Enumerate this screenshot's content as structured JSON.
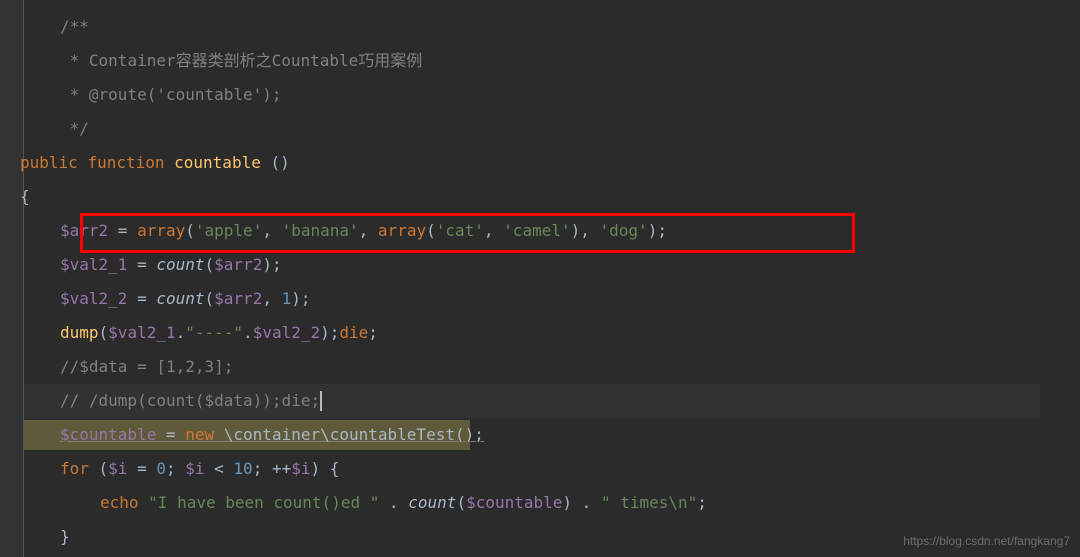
{
  "code": {
    "line1": "/**",
    "line2_prefix": " * ",
    "line2_text": "Container容器类剖析之Countable巧用案例",
    "line3_prefix": " * ",
    "line3_text": "@route('countable');",
    "line4": " */",
    "line5_public": "public",
    "line5_function": "function",
    "line5_name": "countable",
    "line5_parens": " ()",
    "line6": "{",
    "line7_var": "$arr2",
    "line7_eq": " = ",
    "line7_array": "array",
    "line7_open": "(",
    "line7_s1": "'apple'",
    "line7_c1": ", ",
    "line7_s2": "'banana'",
    "line7_c2": ", ",
    "line7_array2": "array",
    "line7_open2": "(",
    "line7_s3": "'cat'",
    "line7_c3": ", ",
    "line7_s4": "'camel'",
    "line7_close2": ")",
    "line7_c4": ", ",
    "line7_s5": "'dog'",
    "line7_close": ");",
    "line8_var": "$val2_1",
    "line8_eq": " = ",
    "line8_count": "count",
    "line8_open": "(",
    "line8_arg": "$arr2",
    "line8_close": ");",
    "line9_var": "$val2_2",
    "line9_eq": " = ",
    "line9_count": "count",
    "line9_open": "(",
    "line9_arg1": "$arr2",
    "line9_c": ", ",
    "line9_arg2": "1",
    "line9_close": ");",
    "line10_dump": "dump",
    "line10_open": "(",
    "line10_v1": "$val2_1",
    "line10_dot1": ".",
    "line10_s": "\"----\"",
    "line10_dot2": ".",
    "line10_v2": "$val2_2",
    "line10_close": ");",
    "line10_die": "die",
    "line10_semi": ";",
    "line11": "//$data = [1,2,3];",
    "line12": "// /dump(count($data));die;",
    "line13_var": "$countable",
    "line13_eq": " = ",
    "line13_new": "new",
    "line13_class": " \\container\\countableTest();",
    "line14_for": "for",
    "line14_open": " (",
    "line14_var": "$i",
    "line14_eq": " = ",
    "line14_zero": "0",
    "line14_semi1": "; ",
    "line14_var2": "$i",
    "line14_lt": " < ",
    "line14_ten": "10",
    "line14_semi2": "; ++",
    "line14_var3": "$i",
    "line14_close": ") {",
    "line15_echo": "echo",
    "line15_s1": " \"I have been count()ed \"",
    "line15_dot1": " . ",
    "line15_count": "count",
    "line15_open": "(",
    "line15_arg": "$countable",
    "line15_close": ")",
    "line15_dot2": " . ",
    "line15_s2": "\" times\\n\"",
    "line15_semi": ";",
    "line16": "}"
  },
  "watermark": "https://blog.csdn.net/fangkang7"
}
